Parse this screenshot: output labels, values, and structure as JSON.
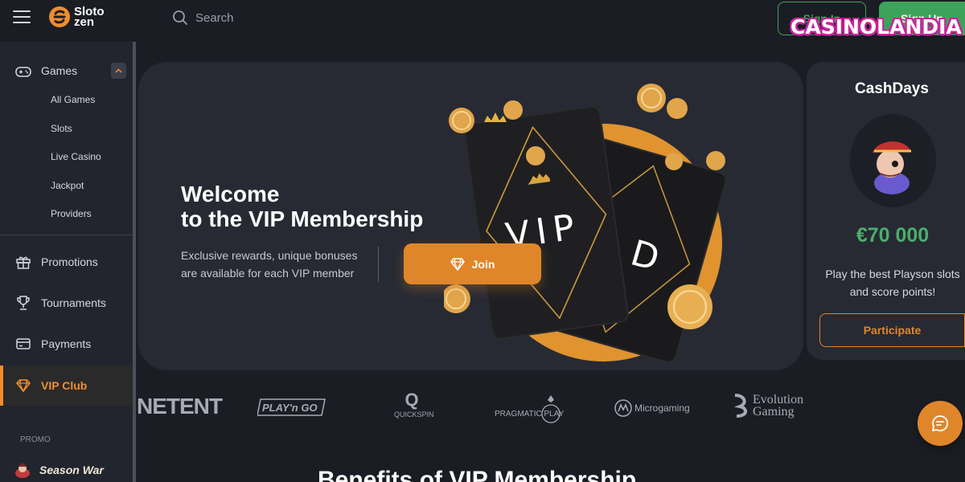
{
  "header": {
    "brand_line1": "Sloto",
    "brand_line2": "zen",
    "search_placeholder": "Search",
    "signin_label": "Sign In",
    "signup_label": "Sign Up",
    "watermark": "CASINOLANDIA"
  },
  "sidebar": {
    "games_label": "Games",
    "game_items": [
      "All Games",
      "Slots",
      "Live Casino",
      "Jackpot",
      "Providers"
    ],
    "promotions_label": "Promotions",
    "tournaments_label": "Tournaments",
    "payments_label": "Payments",
    "vip_label": "VIP Club",
    "promo_section": "PROMO",
    "season_war": "Season War",
    "active_item": "VIP Club"
  },
  "hero": {
    "title_line1": "Welcome",
    "title_line2": "to the VIP Membership",
    "desc_line1": "Exclusive rewards, unique bonuses",
    "desc_line2": "are available for each VIP member",
    "join_label": "Join",
    "card_text": "VIP"
  },
  "cashdays": {
    "title": "CashDays",
    "amount": "€70 000",
    "desc_line1": "Play the best Playson slots",
    "desc_line2": "and score points!",
    "button": "Participate"
  },
  "providers": {
    "netent": "NETENT",
    "playngo": "PLAY'n GO",
    "quickspin_letter": "Q",
    "quickspin": "QUICKSPIN",
    "pragmatic": "PRAGMATIC PLAY",
    "microgaming": "Microgaming",
    "evolution_line1": "Evolution",
    "evolution_line2": "Gaming"
  },
  "section_heading": "Benefits of VIP Membership",
  "colors": {
    "background": "#1b1d24",
    "panel": "#272a33",
    "accent_orange": "#e0862a",
    "accent_green": "#3ea35a"
  },
  "icons": {
    "menu": "hamburger-icon",
    "search": "search-icon",
    "games": "gamepad-icon",
    "promotions": "gift-icon",
    "tournaments": "trophy-icon",
    "payments": "card-icon",
    "vip": "diamond-icon",
    "chat": "chat-icon"
  }
}
